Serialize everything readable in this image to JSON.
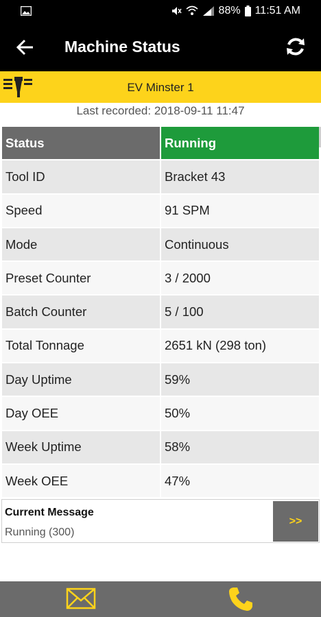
{
  "status_bar": {
    "battery": "88%",
    "time": "11:51 AM",
    "icons": [
      "gallery-icon",
      "mute-icon",
      "wifi-icon",
      "signal-icon",
      "battery-icon"
    ]
  },
  "app_bar": {
    "title": "Machine Status",
    "back_icon": "arrow-left-icon",
    "refresh_icon": "refresh-icon"
  },
  "machine": {
    "name": "EV Minster 1",
    "logo_icon": "press-machine-icon"
  },
  "last_recorded": "Last recorded: 2018-09-11 11:47",
  "status_table": {
    "header": {
      "label": "Status",
      "value": "Running",
      "value_color": "#1e9b3b"
    },
    "rows": [
      {
        "label": "Tool ID",
        "value": "Bracket 43"
      },
      {
        "label": "Speed",
        "value": "91 SPM"
      },
      {
        "label": "Mode",
        "value": "Continuous"
      },
      {
        "label": "Preset Counter",
        "value": "3 / 2000"
      },
      {
        "label": "Batch Counter",
        "value": "5 / 100"
      },
      {
        "label": "Total Tonnage",
        "value": "2651 kN (298 ton)"
      },
      {
        "label": "Day Uptime",
        "value": "59%"
      },
      {
        "label": "Day OEE",
        "value": "50%"
      },
      {
        "label": "Week Uptime",
        "value": "58%"
      },
      {
        "label": "Week OEE",
        "value": "47%"
      }
    ]
  },
  "current_message": {
    "label": "Current Message",
    "value": "Running (300)",
    "more_label": ">>"
  },
  "bottom_bar": {
    "mail_icon": "mail-icon",
    "phone_icon": "phone-icon"
  },
  "colors": {
    "accent": "#fdd31b",
    "running": "#1e9b3b",
    "header_gray": "#6b6b6b"
  }
}
